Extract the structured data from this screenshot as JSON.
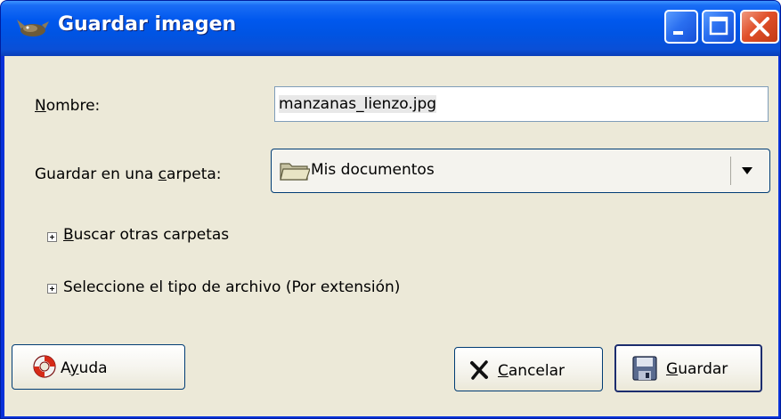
{
  "window": {
    "title": "Guardar imagen",
    "controls": {
      "minimize": "minimize",
      "maximize": "maximize",
      "close": "close"
    },
    "titlebar_color": "#0054e3",
    "client_color": "#ece9d8"
  },
  "form": {
    "name_label_accel": "N",
    "name_label_rest": "ombre:",
    "name_value": "manzanas_lienzo.jpg",
    "folder_label_pre": "Guardar en una ",
    "folder_label_accel": "c",
    "folder_label_post": "arpeta:",
    "folder_value": "Mis documentos"
  },
  "expanders": {
    "browse_accel": "B",
    "browse_rest": "uscar otras carpetas",
    "filetype_label": "Seleccione el tipo de archivo  (Por extensión)"
  },
  "buttons": {
    "help_pre": "A",
    "help_accel": "y",
    "help_post": "uda",
    "cancel_accel": "C",
    "cancel_rest": "ancelar",
    "save_accel": "G",
    "save_rest": "uardar"
  },
  "icons": {
    "app": "gimp-wilber-icon",
    "folder": "folder-icon",
    "help": "lifebuoy-icon",
    "cancel": "x-cancel-icon",
    "save": "floppy-disk-icon"
  }
}
